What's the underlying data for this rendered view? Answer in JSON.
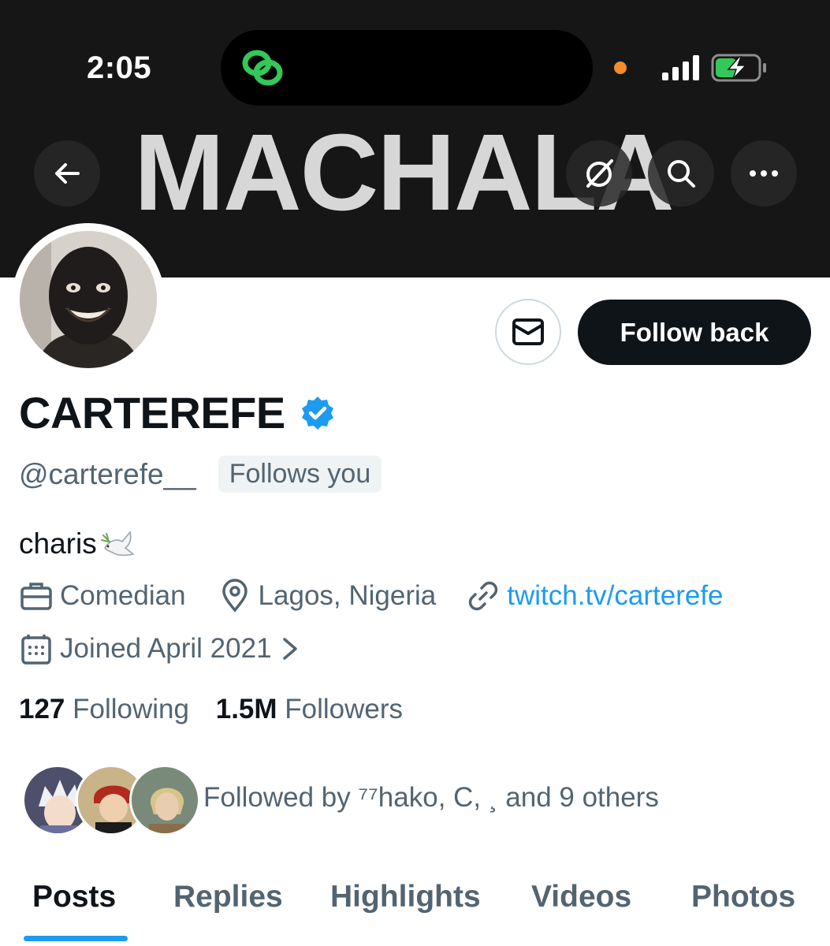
{
  "status_bar": {
    "time": "2:05"
  },
  "banner": {
    "text": "MACHALA"
  },
  "header_icons": [
    "back-arrow-icon",
    "grok-icon",
    "search-icon",
    "more-icon"
  ],
  "profile": {
    "display_name": "CARTEREFE",
    "handle": "@carterefe__",
    "follows_you": "Follows you",
    "bio": "charis",
    "occupation": "Comedian",
    "location": "Lagos, Nigeria",
    "website": "twitch.tv/carterefe",
    "joined": "Joined April 2021",
    "following_count": "127",
    "following_label": "Following",
    "followers_count": "1.5M",
    "followers_label": "Followers",
    "followed_by": "Followed by ⁷⁷hako, C, ¸ and 9 others"
  },
  "actions": {
    "follow_label": "Follow back"
  },
  "tabs": [
    {
      "label": "Posts",
      "active": true
    },
    {
      "label": "Replies",
      "active": false
    },
    {
      "label": "Highlights",
      "active": false
    },
    {
      "label": "Videos",
      "active": false
    },
    {
      "label": "Photos",
      "active": false
    }
  ],
  "colors": {
    "accent": "#1d9bf0",
    "text_primary": "#0f1419",
    "text_secondary": "#536471",
    "banner_bg": "#161616",
    "follow_button_bg": "#0f1419",
    "verified": "#1d9bf0",
    "battery_fill": "#34c759",
    "island_icon": "#34c759"
  }
}
